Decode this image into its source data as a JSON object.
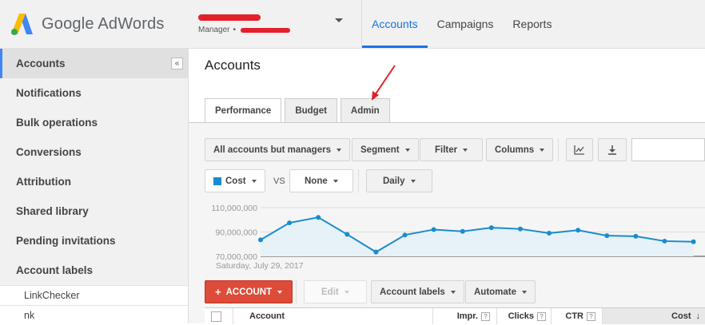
{
  "app": {
    "logo_text": "Google AdWords",
    "manager_label": "Manager",
    "manager_separator": "•"
  },
  "topnav": [
    {
      "label": "Accounts",
      "active": true
    },
    {
      "label": "Campaigns",
      "active": false
    },
    {
      "label": "Reports",
      "active": false
    }
  ],
  "sidebar": {
    "collapse_icon": "«",
    "items": [
      {
        "label": "Accounts",
        "active": true
      },
      {
        "label": "Notifications"
      },
      {
        "label": "Bulk operations"
      },
      {
        "label": "Conversions"
      },
      {
        "label": "Attribution"
      },
      {
        "label": "Shared library"
      },
      {
        "label": "Pending invitations"
      },
      {
        "label": "Account labels"
      }
    ],
    "sub_items": [
      "LinkChecker",
      "nk"
    ]
  },
  "main": {
    "title": "Accounts",
    "tabs": [
      {
        "label": "Performance",
        "active": true
      },
      {
        "label": "Budget"
      },
      {
        "label": "Admin"
      }
    ],
    "toolbar": {
      "scope": "All accounts but managers",
      "segment": "Segment",
      "filter": "Filter",
      "columns": "Columns",
      "chart_icon": "chart-icon",
      "download_icon": "download-icon"
    },
    "chart_controls": {
      "metric1": "Cost",
      "vs": "VS",
      "metric2": "None",
      "interval": "Daily",
      "metric1_color": "#1a8ccc"
    },
    "actions": {
      "add_account": "ACCOUNT",
      "add_prefix": "+",
      "edit": "Edit",
      "account_labels": "Account labels",
      "automate": "Automate"
    },
    "table": {
      "columns": [
        {
          "label": "Account"
        },
        {
          "label": "Impr.",
          "help": "?"
        },
        {
          "label": "Clicks",
          "help": "?"
        },
        {
          "label": "CTR",
          "help": "?"
        },
        {
          "label": "Cost",
          "sort": "↓"
        }
      ]
    }
  },
  "chart_data": {
    "type": "area",
    "series": [
      {
        "values": [
          83500000,
          97500000,
          102000000,
          88000000,
          73500000,
          87500000,
          92000000,
          90500000,
          93500000,
          92500000,
          89000000,
          91500000,
          87000000,
          86500000,
          82500000,
          82000000
        ]
      }
    ],
    "y_ticks": [
      "110,000,000",
      "90,000,000",
      "70,000,000"
    ],
    "ylim": [
      70000000,
      110000000
    ],
    "x_start_label": "Saturday, July 29, 2017",
    "color": "#1a8ccc",
    "fill": "#e6f1f8"
  }
}
